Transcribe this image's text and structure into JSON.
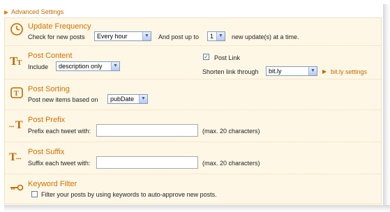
{
  "header": {
    "label": "Advanced Settings",
    "toggle_icon": "triangle-right-icon"
  },
  "update_frequency": {
    "title": "Update Frequency",
    "check_label": "Check for new posts",
    "frequency_value": "Every hour",
    "post_up_to_label": "And post up to",
    "count_value": "1",
    "suffix": "new update(s) at a time."
  },
  "post_content": {
    "title": "Post Content",
    "include_label": "Include",
    "include_value": "description only",
    "post_link_label": "Post Link",
    "post_link_checked": true,
    "shorten_label": "Shorten link through",
    "shortener_value": "bit.ly",
    "settings_link": "bit.ly settings"
  },
  "post_sorting": {
    "title": "Post Sorting",
    "label": "Post new items based on",
    "value": "pubDate"
  },
  "post_prefix": {
    "title": "Post Prefix",
    "label": "Prefix each tweet with:",
    "value": "",
    "hint": "(max. 20 characters)"
  },
  "post_suffix": {
    "title": "Post Suffix",
    "label": "Suffix each tweet with:",
    "value": "",
    "hint": "(max. 20 characters)"
  },
  "keyword_filter": {
    "title": "Keyword Filter",
    "label": "Filter your posts by using keywords to auto-approve new posts.",
    "checked": false
  },
  "colors": {
    "accent": "#d06f00",
    "panel_bg": "#fff7e6"
  }
}
